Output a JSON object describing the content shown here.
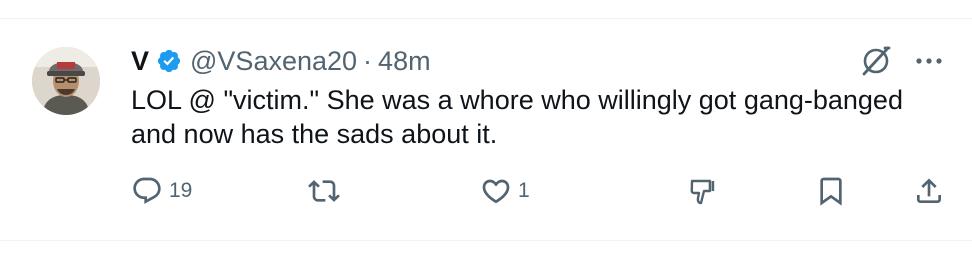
{
  "tweet": {
    "display_name": "V",
    "handle": "@VSaxena20",
    "separator": "·",
    "time": "48m",
    "text": "LOL @ \"victim.\" She was a whore who willingly got gang-banged and now has the sads about it.",
    "actions": {
      "reply_count": "19",
      "like_count": "1"
    }
  },
  "icons": {
    "verified": "verified-badge-icon",
    "grok": "grok-icon",
    "more": "more-icon",
    "reply": "reply-icon",
    "repost": "repost-icon",
    "like": "heart-icon",
    "dislike": "dislike-icon",
    "bookmark": "bookmark-icon",
    "share": "share-icon"
  },
  "colors": {
    "verified": "#1d9bf0",
    "text_primary": "#0f1419",
    "text_secondary": "#536471",
    "divider": "#eff3f4"
  }
}
